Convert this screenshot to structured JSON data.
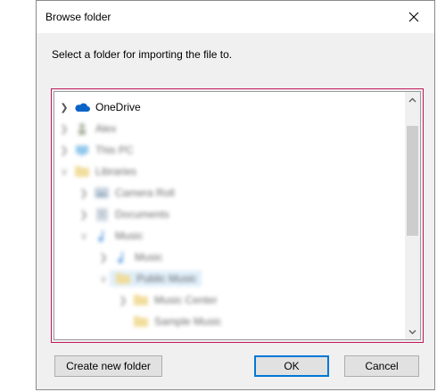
{
  "dialog": {
    "title": "Browse folder",
    "close_icon": "close-icon",
    "instruction": "Select a folder for importing the file to."
  },
  "tree": {
    "items": [
      {
        "label": "OneDrive",
        "icon": "cloud-icon",
        "expanded": false,
        "blurred": false
      },
      {
        "label": "Alex",
        "icon": "user-icon",
        "blurred": true
      },
      {
        "label": "This PC",
        "icon": "computer-icon",
        "blurred": true
      },
      {
        "label": "Libraries",
        "icon": "folder-icon",
        "blurred": true
      },
      {
        "label": "Camera Roll",
        "icon": "pictures-icon",
        "blurred": true
      },
      {
        "label": "Documents",
        "icon": "documents-icon",
        "blurred": true
      },
      {
        "label": "Music",
        "icon": "music-icon",
        "blurred": true
      },
      {
        "label": "Music",
        "icon": "music-icon",
        "blurred": true
      },
      {
        "label": "Public Music",
        "icon": "folder-icon",
        "blurred": true,
        "selected": true
      },
      {
        "label": "Music Center",
        "icon": "folder-icon",
        "blurred": true
      },
      {
        "label": "Sample Music",
        "icon": "folder-icon",
        "blurred": true
      }
    ]
  },
  "buttons": {
    "create_new_folder": "Create new folder",
    "ok": "OK",
    "cancel": "Cancel"
  },
  "colors": {
    "focus_border": "#c2185b",
    "selection": "#cce4f7",
    "onedrive_blue": "#0a64c8",
    "primary_border": "#0078d7"
  }
}
